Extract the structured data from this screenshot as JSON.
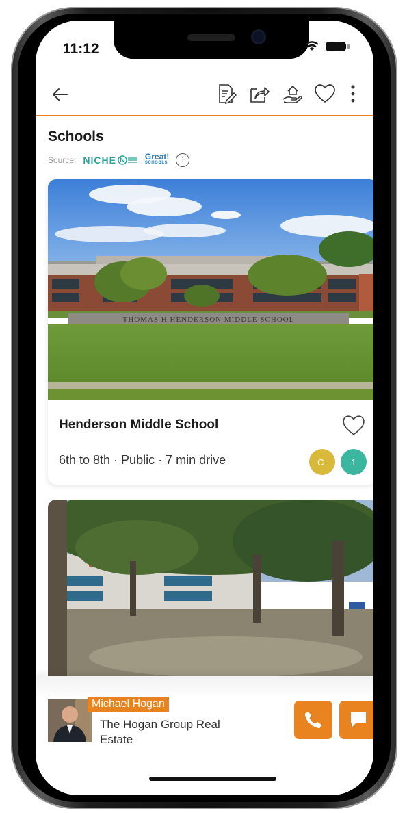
{
  "status": {
    "time": "11:12"
  },
  "section": {
    "title": "Schools",
    "source_label": "Source:",
    "niche_label": "NICHE",
    "great_top": "Great!",
    "great_bottom": "SCHOOLS",
    "info_glyph": "i"
  },
  "school": {
    "photo_sign": "THOMAS H HENDERSON MIDDLE SCHOOL",
    "name": "Henderson Middle School",
    "meta": "6th to 8th · Public · 7 min drive",
    "niche_grade": "C-",
    "great_rating": "1",
    "niche_color": "#d9b93a",
    "great_color": "#3bb7a0"
  },
  "agent": {
    "name": "Michael Hogan",
    "company": "The Hogan Group Real Estate"
  },
  "colors": {
    "accent": "#e8831f"
  },
  "icons": [
    "back-arrow-icon",
    "document-edit-icon",
    "share-icon",
    "hand-home-icon",
    "heart-icon",
    "more-vertical-icon",
    "phone-icon",
    "chat-icon"
  ]
}
